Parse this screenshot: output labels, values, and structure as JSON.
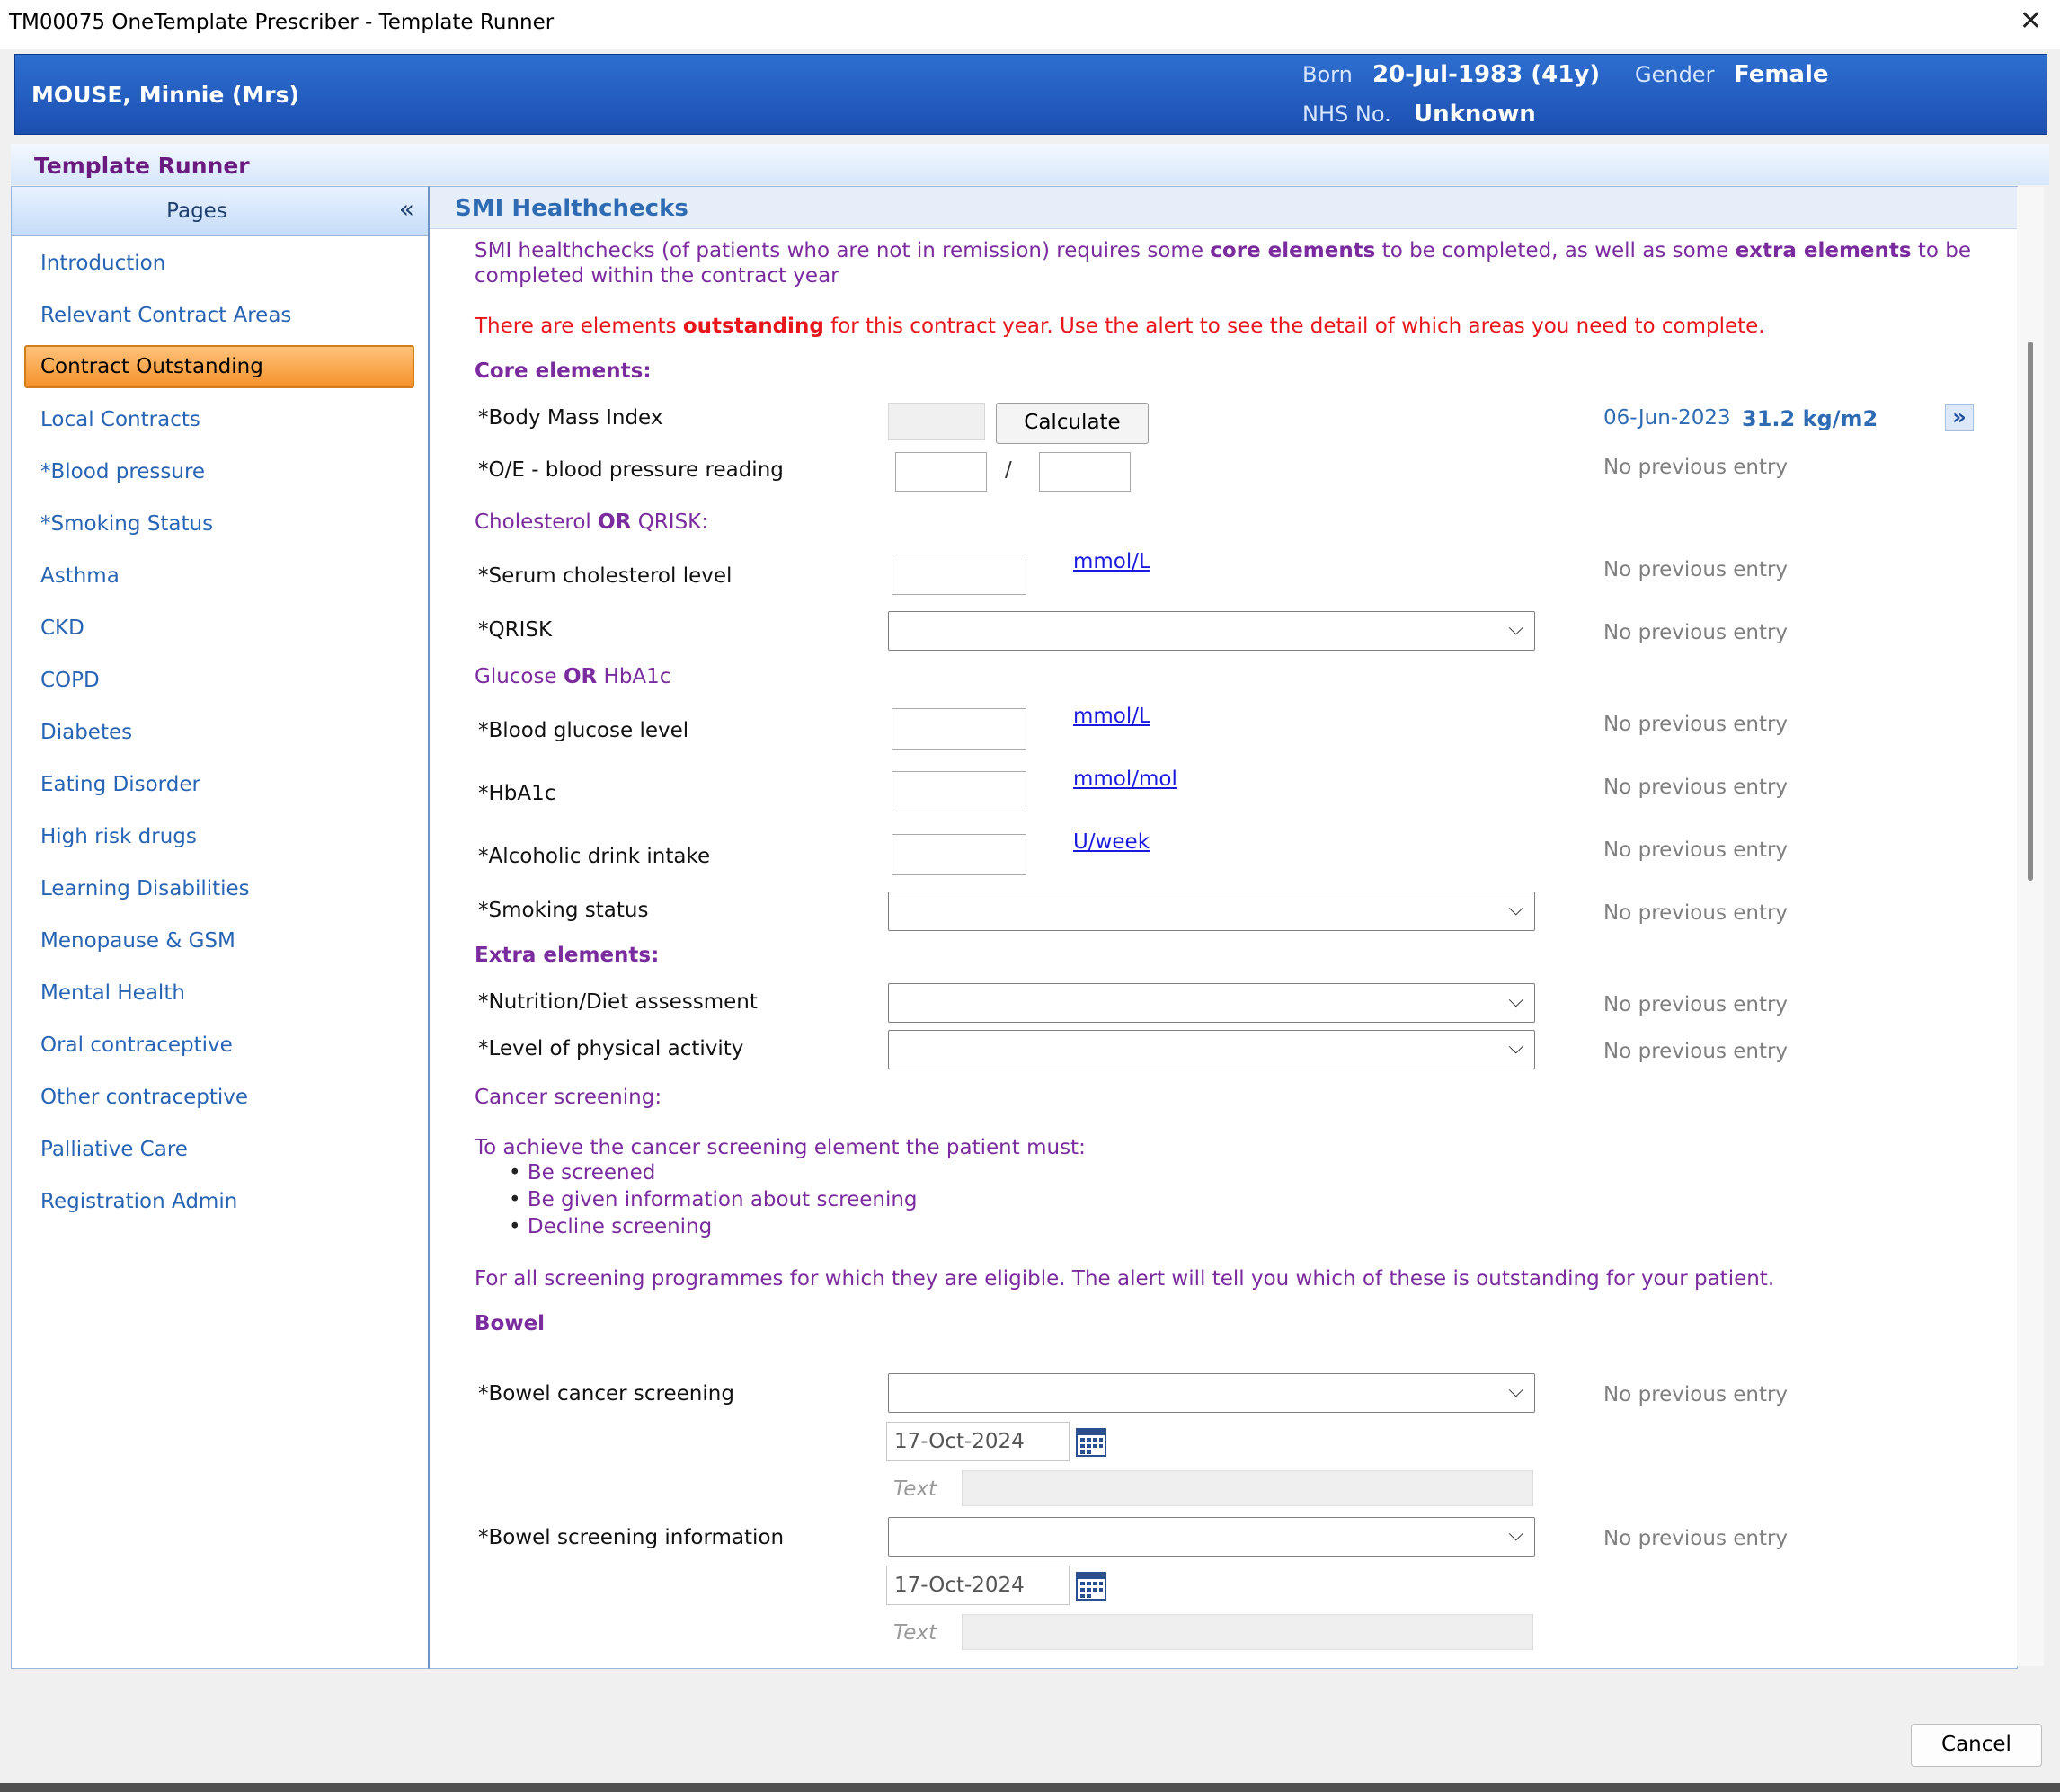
{
  "window": {
    "title": "TM00075 OneTemplate Prescriber - Template Runner",
    "close_label": "✕"
  },
  "patient": {
    "name": "MOUSE, Minnie (Mrs)",
    "born_label": "Born",
    "born_value": "20-Jul-1983 (41y)",
    "gender_label": "Gender",
    "gender_value": "Female",
    "nhs_label": "NHS No.",
    "nhs_value": "Unknown"
  },
  "header": {
    "title": "Template Runner"
  },
  "sidebar": {
    "title": "Pages",
    "collapse_label": "«",
    "items": [
      "Introduction",
      "Relevant Contract Areas",
      "Contract Outstanding",
      "Local Contracts",
      "*Blood pressure",
      "*Smoking Status",
      "Asthma",
      "CKD",
      "COPD",
      "Diabetes",
      "Eating Disorder",
      "High risk drugs",
      "Learning Disabilities",
      "Menopause & GSM",
      "Mental Health",
      "Oral contraceptive",
      "Other contraceptive",
      "Palliative Care",
      "Registration Admin"
    ],
    "selected_index": 2
  },
  "main": {
    "title": "SMI Healthchecks",
    "intro_1a": "SMI healthchecks (of patients who are not in remission) requires some ",
    "intro_core": "core elements",
    "intro_1b": " to be completed, as well as some ",
    "intro_extra": "extra elements",
    "intro_1c": " to be",
    "intro_2": "completed within the contract year",
    "alert_a": "There are elements ",
    "alert_b": "outstanding",
    "alert_c": " for this contract year.  Use the alert to see the detail of which areas you need to complete.",
    "core_heading": "Core elements:",
    "bmi_label": "*Body Mass Index",
    "calculate_label": "Calculate",
    "bmi_prev_date": "06-Jun-2023",
    "bmi_prev_value": "31.2 kg/m2",
    "bmi_more": "»",
    "bp_label": "*O/E - blood pressure reading",
    "bp_sep": "/",
    "chol_heading_a": "Cholesterol ",
    "chol_heading_or": "OR",
    "chol_heading_b": " QRISK:",
    "chol_label": "*Serum cholesterol level",
    "chol_unit": "mmol/L",
    "qrisk_label": "*QRISK",
    "glucose_heading_a": "Glucose ",
    "glucose_heading_or": "OR",
    "glucose_heading_b": " HbA1c",
    "glucose_label": "*Blood glucose level",
    "glucose_unit": "mmol/L",
    "hba1c_label": "*HbA1c",
    "hba1c_unit": "mmol/mol",
    "alcohol_label": "*Alcoholic drink intake",
    "alcohol_unit": "U/week",
    "smoking_label": "*Smoking status",
    "extra_heading": "Extra elements:",
    "nutrition_label": "*Nutrition/Diet assessment",
    "activity_label": "*Level of physical activity",
    "cancer_heading": "Cancer screening:",
    "cancer_intro": "To achieve the cancer screening element the patient must:",
    "cancer_bullets": [
      "Be screened",
      "Be given information about screening",
      "Decline screening"
    ],
    "cancer_note": "For all screening programmes for which they are eligible.  The alert will tell you which of these is outstanding for your patient.",
    "bowel_heading": "Bowel",
    "bowel_screen_label": "*Bowel cancer screening",
    "bowel_info_label": "*Bowel screening information",
    "date_value": "17-Oct-2024",
    "text_placeholder": "Text",
    "no_prev": "No previous entry"
  },
  "footer": {
    "cancel_label": "Cancel"
  },
  "colors": {
    "banner": "#1c4fb0",
    "accent_purple": "#7a2b9e",
    "alert_red": "#e8151b",
    "link_blue": "#2864b4",
    "selected_orange": "#f5922c"
  }
}
